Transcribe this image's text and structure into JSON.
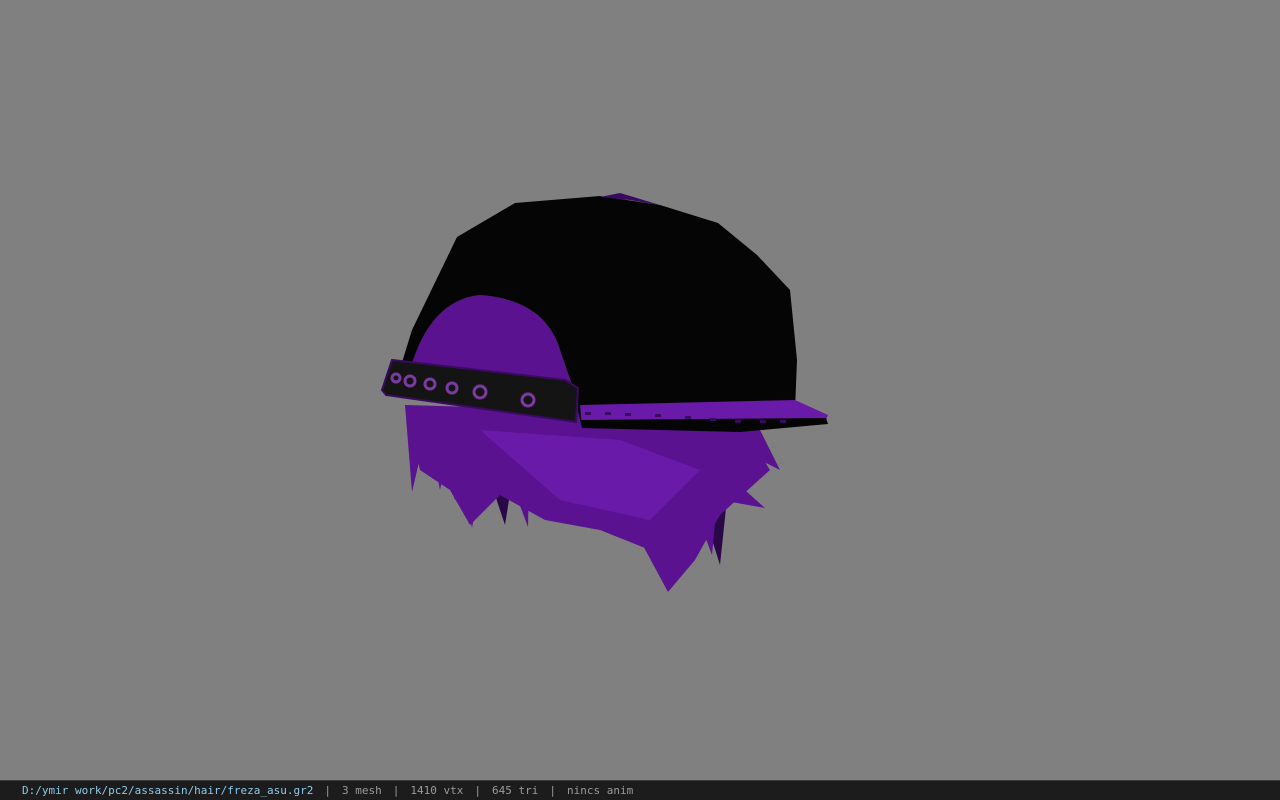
{
  "viewport": {
    "background_color": "#808080",
    "model": {
      "description_icon": "hair-cap-model-icon",
      "cap_color": "#050505",
      "hair_color": "#5a1290",
      "hair_shadow_color": "#2a0848",
      "strap_color": "#141414",
      "rivet_color": "#7a3aa0"
    }
  },
  "status_bar": {
    "file_path": "D:/ymir work/pc2/assassin/hair/freza_asu.gr2",
    "separator": "|",
    "mesh_count": "3 mesh",
    "vertex_count": "1410 vtx",
    "triangle_count": "645 tri",
    "animation": "nincs anim",
    "path_color": "#8ec8e8",
    "text_color": "#9a9a9a"
  }
}
